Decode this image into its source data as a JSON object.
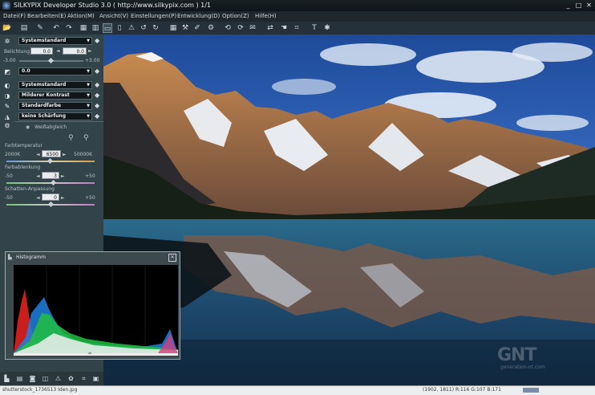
{
  "window": {
    "title": "SILKYPIX Developer Studio 3.0 ( http://www.silkypix.com )   1/1",
    "minimize": "_",
    "maximize": "□",
    "close": "✕"
  },
  "menu": [
    "Datei(F)",
    "Bearbeiten(E)",
    "Aktion(M)",
    "Ansicht(V)",
    "Einstellungen(P)",
    "Entwicklung(D)",
    "Option(Z)",
    "Hilfe(H)"
  ],
  "panel": {
    "preset": "Systemstandard",
    "exposure_label": "Belichtung",
    "exposure_value": "0.0",
    "exposure_value2": "0.0",
    "exposure_min": "-3.00",
    "exposure_max": "+3.00",
    "tone_value": "0.0",
    "white_balance": "Systemstandard",
    "contrast": "Milderer Kontrast",
    "color": "Standardfarbe",
    "sharpness": "keine Schärfung",
    "wb_button": "Weißabgleich",
    "colortemp_label": "Farbtemperatur",
    "colortemp_min": "2000K",
    "colortemp_value": "6500",
    "colortemp_max": "50000K",
    "colortint_label": "Farbablenkung",
    "colortint_min": "-50",
    "colortint_value": "3",
    "colortint_max": "+50",
    "shadow_label": "Schatten-Anpassung",
    "shadow_min": "-50",
    "shadow_value": "0",
    "shadow_max": "+50"
  },
  "histogram": {
    "title": "Histogramm",
    "close": "✕"
  },
  "status": {
    "filename": "shutterstock_1736513 Iden.jpg",
    "coords": "(1902, 1811)  R:116 G:107 B:171"
  },
  "watermark": {
    "logo": "GNT",
    "sub": "generation-nt.com"
  },
  "colors": {
    "panel_bg": "#33434a",
    "titlebar": "#0e1416",
    "dropdown_bg": "#10171a",
    "statusbar": "#eceff0"
  },
  "icons": {
    "exposure": "sun-icon",
    "tone": "tone-curve-icon",
    "wb": "white-balance-icon",
    "contrast": "contrast-icon",
    "color": "color-icon",
    "sharpness": "sharpness-icon"
  }
}
